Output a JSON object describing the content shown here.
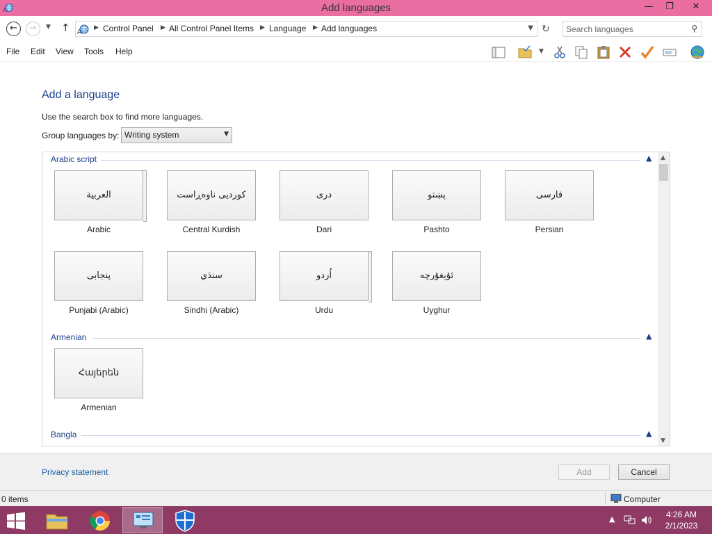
{
  "window": {
    "title": "Add languages",
    "minimize": "—",
    "maximize": "❐",
    "close": "✕"
  },
  "address": {
    "breadcrumbs": [
      "Control Panel",
      "All Control Panel Items",
      "Language",
      "Add languages"
    ],
    "search_placeholder": "Search languages"
  },
  "menu": {
    "items": [
      "File",
      "Edit",
      "View",
      "Tools",
      "Help"
    ]
  },
  "toolbar": {
    "icons": [
      "layout-icon",
      "folder-check-icon",
      "cut-icon",
      "copy-icon",
      "paste-icon",
      "delete-icon",
      "properties-check-icon",
      "rename-icon",
      "globe-icon"
    ]
  },
  "main": {
    "heading": "Add a language",
    "instruction": "Use the search box to find more languages.",
    "group_by_label": "Group languages by:",
    "group_by_value": "Writing system"
  },
  "groups": [
    {
      "name": "Arabic script",
      "languages": [
        {
          "native": "العربية",
          "label": "Arabic",
          "stacked": true
        },
        {
          "native": "کوردیی ناوەڕاست",
          "label": "Central Kurdish",
          "stacked": false
        },
        {
          "native": "درى",
          "label": "Dari",
          "stacked": false
        },
        {
          "native": "پښتو",
          "label": "Pashto",
          "stacked": false
        },
        {
          "native": "فارسى",
          "label": "Persian",
          "stacked": false
        },
        {
          "native": "پنجابی",
          "label": "Punjabi (Arabic)",
          "stacked": false
        },
        {
          "native": "سنڌي",
          "label": "Sindhi (Arabic)",
          "stacked": false
        },
        {
          "native": "اُردو",
          "label": "Urdu",
          "stacked": true
        },
        {
          "native": "ئۇيغۇرچە",
          "label": "Uyghur",
          "stacked": false
        }
      ]
    },
    {
      "name": "Armenian",
      "languages": [
        {
          "native": "Հայերեն",
          "label": "Armenian",
          "stacked": false
        }
      ]
    },
    {
      "name": "Bangla",
      "languages": []
    }
  ],
  "footer": {
    "privacy": "Privacy statement",
    "add_button": "Add",
    "cancel_button": "Cancel"
  },
  "status": {
    "items": "0 items",
    "location": "Computer"
  },
  "taskbar": {
    "time": "4:26 AM",
    "date": "2/1/2023"
  },
  "colors": {
    "titlebar": "#ea6ea2",
    "taskbar": "#8e3a64",
    "heading": "#1d3f87",
    "link": "#1d5aa6"
  }
}
